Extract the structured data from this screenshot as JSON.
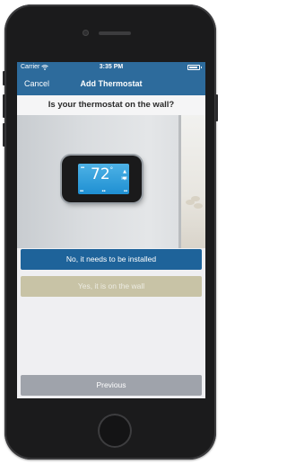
{
  "status_bar": {
    "carrier": "Carrier",
    "time": "3:35 PM"
  },
  "nav": {
    "cancel_label": "Cancel",
    "title": "Add Thermostat"
  },
  "question": "Is your thermostat on the wall?",
  "thermostat_display": {
    "temperature": "72",
    "degree": "°"
  },
  "buttons": {
    "needs_install": "No, it needs to be installed",
    "on_wall": "Yes, it is on the wall",
    "previous": "Previous"
  },
  "colors": {
    "header": "#2d6b9c",
    "primary_button": "#1e639a",
    "secondary_button": "#c8c3a6",
    "previous_button": "#9fa3ab"
  },
  "icons": [
    "wifi-icon",
    "battery-icon",
    "thermostat-image",
    "home-button"
  ]
}
